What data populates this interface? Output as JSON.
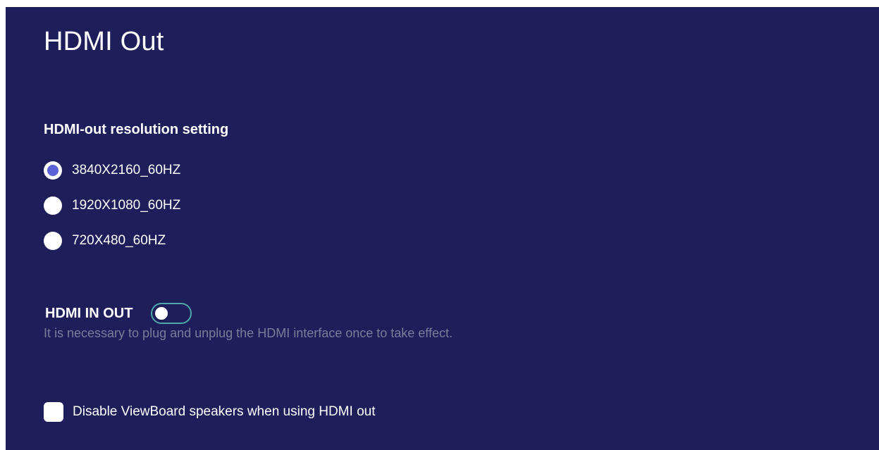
{
  "page": {
    "title": "HDMI Out"
  },
  "resolution": {
    "heading": "HDMI-out resolution setting",
    "options": [
      {
        "label": "3840X2160_60HZ",
        "selected": true
      },
      {
        "label": "1920X1080_60HZ",
        "selected": false
      },
      {
        "label": "720X480_60HZ",
        "selected": false
      }
    ]
  },
  "hdmi_in_out": {
    "label": "HDMI IN OUT",
    "enabled": false,
    "hint": "It is necessary to plug and unplug the HDMI interface once to take effect."
  },
  "speakers": {
    "label": "Disable ViewBoard speakers when using HDMI out",
    "checked": false
  },
  "colors": {
    "background": "#1e1f5a",
    "radio_selected": "#5b62d8",
    "toggle_border": "#4fa6a8",
    "hint_text": "#7a7c9c"
  }
}
